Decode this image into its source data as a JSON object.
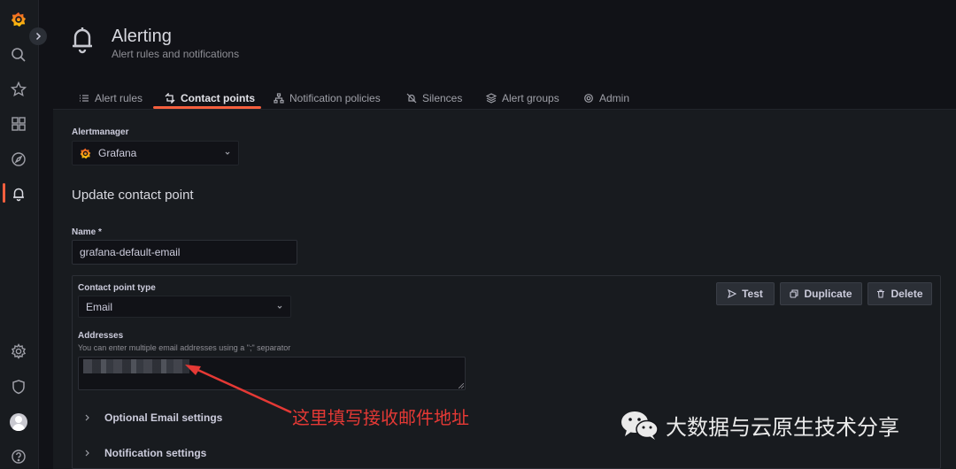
{
  "header": {
    "title": "Alerting",
    "subtitle": "Alert rules and notifications"
  },
  "tabs": [
    {
      "label": "Alert rules",
      "icon": "list-icon",
      "active": false
    },
    {
      "label": "Contact points",
      "icon": "contact-point-icon",
      "active": true
    },
    {
      "label": "Notification policies",
      "icon": "sitemap-icon",
      "active": false
    },
    {
      "label": "Silences",
      "icon": "bell-slash-icon",
      "active": false
    },
    {
      "label": "Alert groups",
      "icon": "layer-group-icon",
      "active": false
    },
    {
      "label": "Admin",
      "icon": "cog-icon",
      "active": false
    }
  ],
  "form": {
    "alertmanager_label": "Alertmanager",
    "alertmanager_value": "Grafana",
    "section_title": "Update contact point",
    "name_label": "Name *",
    "name_value": "grafana-default-email",
    "contact_type_label": "Contact point type",
    "contact_type_value": "Email",
    "addresses_label": "Addresses",
    "addresses_description": "You can enter multiple email addresses using a \";\" separator",
    "optional_settings": "Optional Email settings",
    "notification_settings": "Notification settings"
  },
  "actions": {
    "test": "Test",
    "duplicate": "Duplicate",
    "delete": "Delete"
  },
  "annotation": {
    "text": "这里填写接收邮件地址"
  },
  "watermark": {
    "text": "大数据与云原生技术分享"
  },
  "colors": {
    "accent": "#f55f3e",
    "background": "#111217",
    "panel": "#181b1f",
    "annotation": "#e53935"
  }
}
